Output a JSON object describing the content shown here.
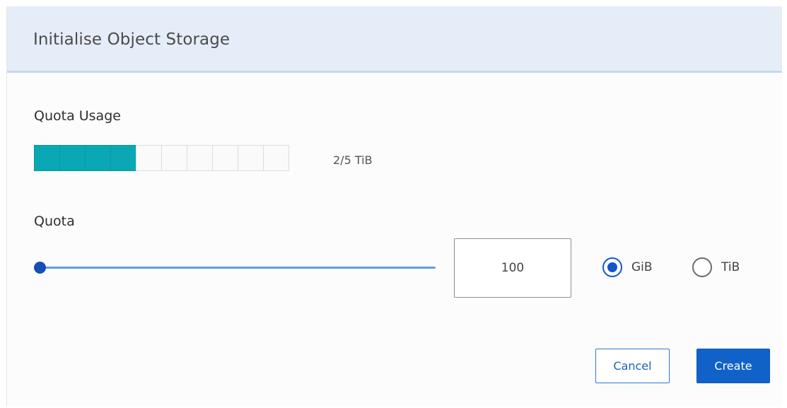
{
  "dialog": {
    "title": "Initialise Object Storage"
  },
  "usage": {
    "label": "Quota Usage",
    "text": "2/5 TiB",
    "segments_total": 10,
    "segments_filled": 4,
    "fill_color": "#0aa7b4"
  },
  "quota": {
    "label": "Quota",
    "slider_value_fraction": 0.0,
    "input_value": "100",
    "units": [
      {
        "label": "GiB",
        "selected": true
      },
      {
        "label": "TiB",
        "selected": false
      }
    ]
  },
  "buttons": {
    "cancel": "Cancel",
    "create": "Create"
  },
  "colors": {
    "accent": "#1062c9",
    "header_bg": "#e5edf8",
    "slider_track": "#5e9de6"
  }
}
